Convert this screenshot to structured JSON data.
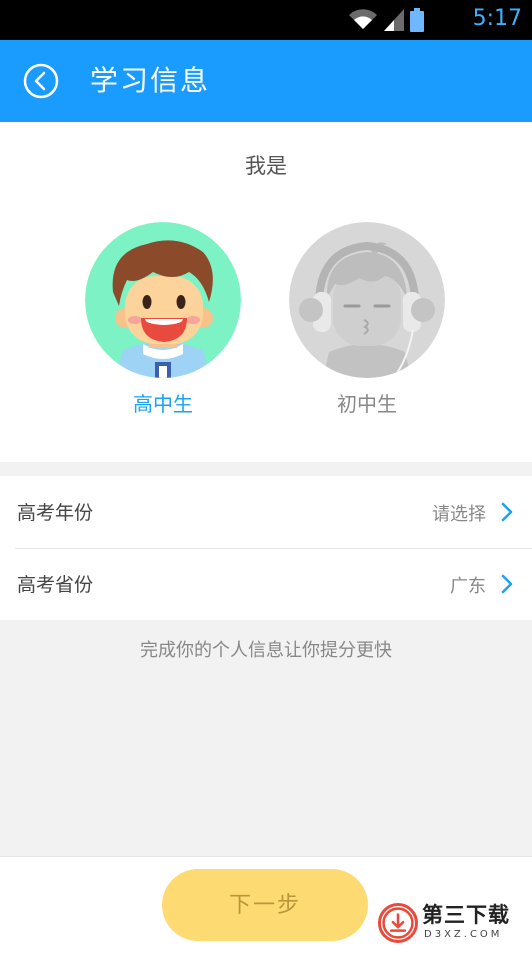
{
  "status": {
    "time": "5:17"
  },
  "header": {
    "title": "学习信息"
  },
  "identity": {
    "prompt": "我是",
    "options": [
      {
        "label": "高中生",
        "selected": true
      },
      {
        "label": "初中生",
        "selected": false
      }
    ]
  },
  "form": {
    "rows": [
      {
        "label": "高考年份",
        "value": "请选择"
      },
      {
        "label": "高考省份",
        "value": "广东"
      }
    ]
  },
  "hint": "完成你的个人信息让你提分更快",
  "footer": {
    "next_label": "下一步"
  },
  "watermark": {
    "text": "第三下载",
    "sub": "D3XZ.COM"
  },
  "colors": {
    "accent": "#1a9cff",
    "selected_text": "#1aa3ee",
    "button": "#fddb72"
  }
}
